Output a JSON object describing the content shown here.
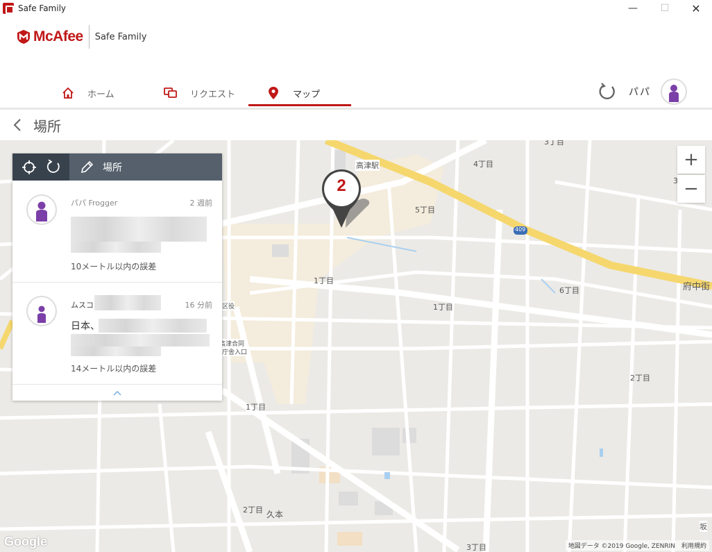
{
  "window": {
    "title": "Safe Family",
    "min": "—",
    "max": "☐",
    "close": "✕"
  },
  "brand": {
    "name": "McAfee",
    "product": "Safe Family"
  },
  "nav": {
    "tabs": [
      {
        "label": "ホーム",
        "icon": "home-icon"
      },
      {
        "label": "リクエスト",
        "icon": "request-icon"
      },
      {
        "label": "マップ",
        "icon": "map-pin-icon",
        "active": true
      }
    ],
    "user_name": "パパ"
  },
  "page": {
    "title": "場所"
  },
  "panel": {
    "toolbar_label": "場所",
    "entries": [
      {
        "name": "パパ Frogger",
        "time": "2 週前",
        "address": "",
        "accuracy": "10メートル以内の誤差"
      },
      {
        "name": "ムスコ",
        "time": "16 分前",
        "address": "日本、",
        "accuracy": "14メートル以内の誤差"
      }
    ],
    "collapse_icon": "chevron-up-icon"
  },
  "map": {
    "marker_label": "2",
    "labels": [
      "3丁目",
      "4丁目",
      "高津駅",
      "5丁目",
      "1丁目",
      "1丁目",
      "6丁目",
      "府中街",
      "3",
      "409",
      "2丁目",
      "1丁目",
      "2丁目",
      "久本",
      "3丁目",
      "坂",
      "高津合同",
      "庁舎入口",
      "区役"
    ],
    "zoom_in": "+",
    "zoom_out": "−",
    "google": "Google",
    "attribution": "地図データ ©2019 Google, ZENRIN　利用規約"
  },
  "colors": {
    "accent": "#c01818",
    "avatar_purple": "#7b3fa8",
    "toolbar_dark": "#38424d",
    "toolbar": "#55606c",
    "highway": "#f5d76e"
  }
}
